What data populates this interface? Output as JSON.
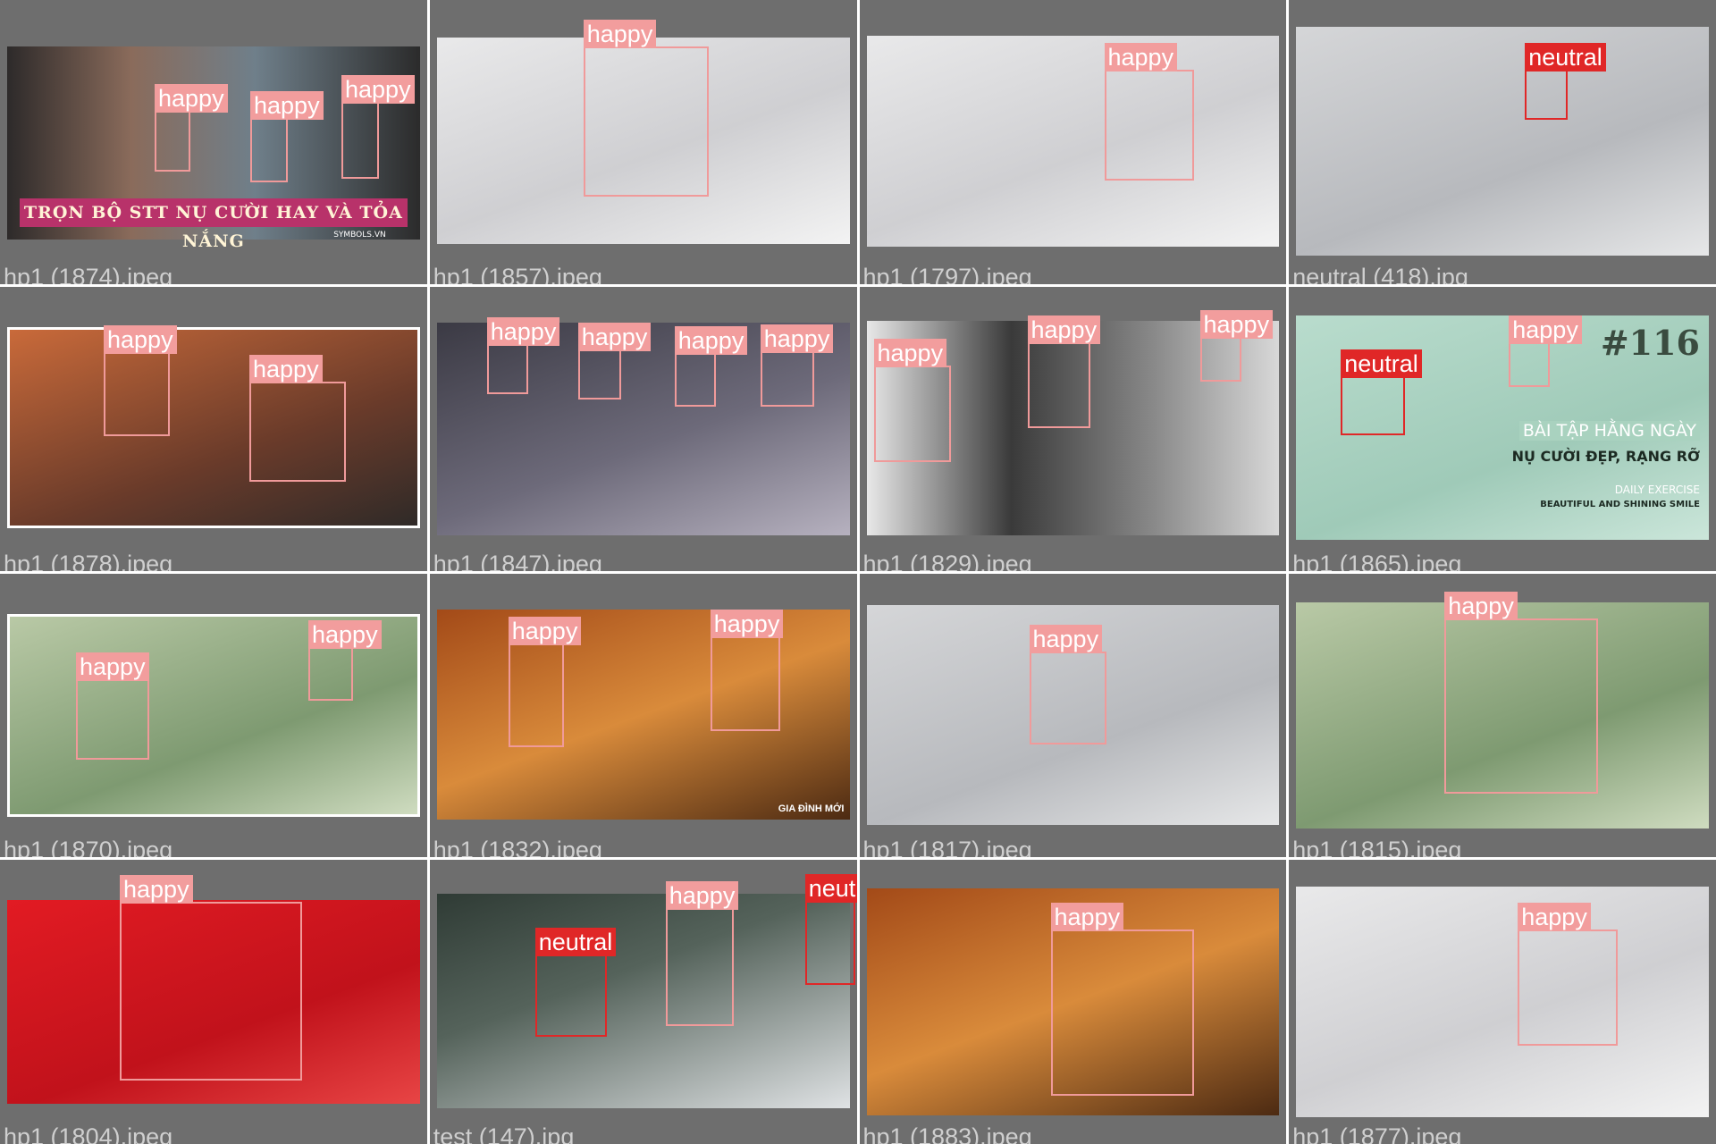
{
  "colors": {
    "cell_background": "#6e6e6e",
    "happy_label": "#f29d9d",
    "neutral_label": "#e02727",
    "filename_text": "#cfcfcf"
  },
  "cells": [
    {
      "filename": "hp1 (1874).jpeg",
      "labels": [
        "happy",
        "happy",
        "happy"
      ],
      "overlay": {
        "banner": "TRỌN BỘ STT NỤ CƯỜI HAY VÀ TỎA NẮNG",
        "source": "SYMBOLS.VN"
      }
    },
    {
      "filename": "hp1 (1857).jpeg",
      "labels": [
        "happy"
      ]
    },
    {
      "filename": "hp1 (1797).jpeg",
      "labels": [
        "happy"
      ]
    },
    {
      "filename": "neutral (418).jpg",
      "labels": [
        "neutral"
      ]
    },
    {
      "filename": "hp1 (1878).jpeg",
      "labels": [
        "happy",
        "happy"
      ]
    },
    {
      "filename": "hp1 (1847).jpeg",
      "labels": [
        "happy",
        "happy",
        "happy",
        "happy"
      ]
    },
    {
      "filename": "hp1 (1829).jpeg",
      "labels": [
        "happy",
        "happy",
        "happy"
      ]
    },
    {
      "filename": "hp1 (1865).jpeg",
      "labels": [
        "neutral",
        "happy"
      ],
      "overlay": {
        "number": "#116",
        "line1": "BÀI TẬP HẰNG NGÀY",
        "line2": "NỤ CƯỜI ĐẸP, RẠNG RỠ",
        "line3": "DAILY EXERCISE",
        "line4": "BEAUTIFUL AND SHINING SMILE"
      }
    },
    {
      "filename": "hp1 (1870).jpeg",
      "labels": [
        "happy",
        "happy"
      ]
    },
    {
      "filename": "hp1 (1832).jpeg",
      "labels": [
        "happy",
        "happy"
      ],
      "overlay": {
        "watermark": "GIA ĐÌNH MỚI"
      }
    },
    {
      "filename": "hp1 (1817).jpeg",
      "labels": [
        "happy"
      ]
    },
    {
      "filename": "hp1 (1815).jpeg",
      "labels": [
        "happy"
      ]
    },
    {
      "filename": "hp1 (1804).jpeg",
      "labels": [
        "happy"
      ]
    },
    {
      "filename": "test (147).jpg",
      "labels": [
        "neutral",
        "happy",
        "neutral"
      ]
    },
    {
      "filename": "hp1 (1883).jpeg",
      "labels": [
        "happy"
      ]
    },
    {
      "filename": "hp1 (1877).jpeg",
      "labels": [
        "happy"
      ]
    }
  ]
}
